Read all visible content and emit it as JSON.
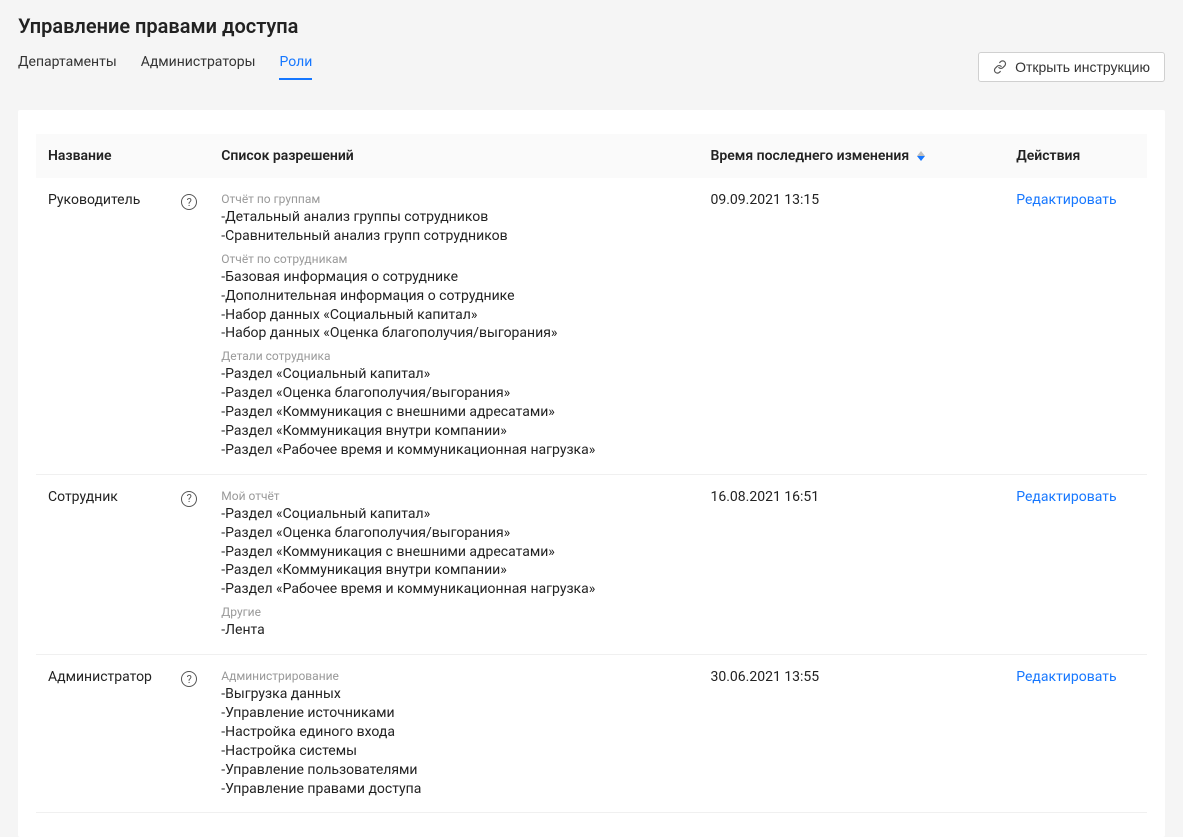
{
  "header": {
    "title": "Управление правами доступа",
    "open_instruction": "Открыть инструкцию"
  },
  "tabs": [
    {
      "label": "Департаменты",
      "active": false
    },
    {
      "label": "Администраторы",
      "active": false
    },
    {
      "label": "Роли",
      "active": true
    }
  ],
  "table": {
    "columns": {
      "name": "Название",
      "permissions": "Список разрешений",
      "last_modified": "Время последнего изменения",
      "actions": "Действия"
    },
    "edit_label": "Редактировать",
    "rows": [
      {
        "name": "Руководитель",
        "last_modified": "09.09.2021 13:15",
        "permission_groups": [
          {
            "title": "Отчёт по группам",
            "items": [
              "Детальный анализ группы сотрудников",
              "Сравнительный анализ групп сотрудников"
            ]
          },
          {
            "title": "Отчёт по сотрудникам",
            "items": [
              "Базовая информация о сотруднике",
              "Дополнительная информация о сотруднике",
              "Набор данных «Социальный капитал»",
              "Набор данных «Оценка благополучия/выгорания»"
            ]
          },
          {
            "title": "Детали сотрудника",
            "items": [
              "Раздел «Социальный капитал»",
              "Раздел «Оценка благополучия/выгорания»",
              "Раздел «Коммуникация с внешними адресатами»",
              "Раздел «Коммуникация внутри компании»",
              "Раздел «Рабочее время и коммуникационная нагрузка»"
            ]
          }
        ]
      },
      {
        "name": "Сотрудник",
        "last_modified": "16.08.2021 16:51",
        "permission_groups": [
          {
            "title": "Мой отчёт",
            "items": [
              "Раздел «Социальный капитал»",
              "Раздел «Оценка благополучия/выгорания»",
              "Раздел «Коммуникация с внешними адресатами»",
              "Раздел «Коммуникация внутри компании»",
              "Раздел «Рабочее время и коммуникационная нагрузка»"
            ]
          },
          {
            "title": "Другие",
            "items": [
              "Лента"
            ]
          }
        ]
      },
      {
        "name": "Администратор",
        "last_modified": "30.06.2021 13:55",
        "permission_groups": [
          {
            "title": "Администрирование",
            "items": [
              "Выгрузка данных",
              "Управление источниками",
              "Настройка единого входа",
              "Настройка системы",
              "Управление пользователями",
              "Управление правами доступа"
            ]
          }
        ]
      }
    ]
  }
}
